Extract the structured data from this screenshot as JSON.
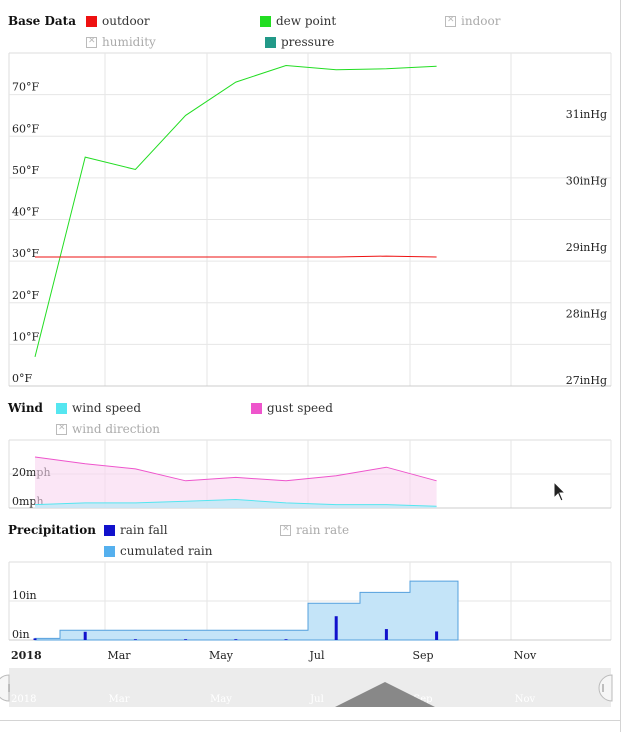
{
  "sections": {
    "base": {
      "title": "Base Data",
      "legend": [
        {
          "label": "outdoor",
          "color": "#ee1111",
          "enabled": true
        },
        {
          "label": "dew point",
          "color": "#22dd22",
          "enabled": true
        },
        {
          "label": "indoor",
          "color": "#bbbbbb",
          "enabled": false
        },
        {
          "label": "humidity",
          "color": "#bbbbbb",
          "enabled": false
        },
        {
          "label": "pressure",
          "color": "#229988",
          "enabled": true
        }
      ]
    },
    "wind": {
      "title": "Wind",
      "legend": [
        {
          "label": "wind speed",
          "color": "#55e6f0",
          "enabled": true
        },
        {
          "label": "gust speed",
          "color": "#ee55cc",
          "enabled": true
        },
        {
          "label": "wind direction",
          "color": "#bbbbbb",
          "enabled": false
        }
      ]
    },
    "precip": {
      "title": "Precipitation",
      "legend": [
        {
          "label": "rain fall",
          "color": "#1111cc",
          "enabled": true
        },
        {
          "label": "rain rate",
          "color": "#bbbbbb",
          "enabled": false
        },
        {
          "label": "cumulated rain",
          "color": "#55b0ee",
          "enabled": true
        }
      ]
    }
  },
  "chart_data": [
    {
      "type": "line",
      "x_ticks": [
        "2018",
        "Mar",
        "May",
        "Jul",
        "Sep",
        "Nov"
      ],
      "x_dates": [
        "2018-01-01",
        "2018-02-01",
        "2018-03-01",
        "2018-04-01",
        "2018-05-01",
        "2018-06-01",
        "2018-07-01",
        "2018-08-01",
        "2018-09-01"
      ],
      "y_ticks": [
        "0°F",
        "10°F",
        "20°F",
        "30°F",
        "40°F",
        "50°F",
        "60°F",
        "70°F"
      ],
      "ylim": [
        0,
        80
      ],
      "y2_ticks": [
        "27inHg",
        "28inHg",
        "29inHg",
        "30inHg",
        "31inHg"
      ],
      "y2lim": [
        27,
        32
      ],
      "series": [
        {
          "name": "dew point",
          "color": "#22dd22",
          "values": [
            7,
            55,
            52,
            65,
            73,
            77,
            76,
            76.2,
            76.8
          ]
        },
        {
          "name": "outdoor",
          "color": "#ee1111",
          "values": [
            31,
            31,
            31,
            31,
            31,
            31,
            31,
            31.2,
            31
          ]
        }
      ]
    },
    {
      "type": "area",
      "x_ticks": [
        "2018",
        "Mar",
        "May",
        "Jul",
        "Sep",
        "Nov"
      ],
      "y_ticks": [
        "0mph",
        "20mph"
      ],
      "ylim": [
        0,
        40
      ],
      "series": [
        {
          "name": "gust speed",
          "color": "#ee55cc",
          "values": [
            30,
            26,
            23,
            16,
            18,
            16,
            19,
            24,
            16
          ]
        },
        {
          "name": "wind speed",
          "color": "#55e6f0",
          "values": [
            2,
            3,
            3,
            4,
            5,
            3,
            2,
            2,
            1
          ]
        }
      ]
    },
    {
      "type": "bar",
      "x_ticks": [
        "2018",
        "Mar",
        "May",
        "Jul",
        "Sep",
        "Nov"
      ],
      "y_ticks": [
        "0in",
        "10in"
      ],
      "ylim": [
        0,
        20
      ],
      "series": [
        {
          "name": "rain fall",
          "color": "#1111cc",
          "values": [
            0.4,
            2.1,
            0.2,
            0.2,
            0.2,
            0.2,
            6.1,
            2.8,
            2.2
          ]
        },
        {
          "name": "cumulated rain",
          "color": "#55b0ee",
          "values": [
            0.4,
            2.5,
            2.5,
            2.5,
            2.5,
            2.5,
            9.4,
            12.2,
            15.1
          ]
        }
      ]
    }
  ],
  "navigator": {
    "labels": [
      "2018",
      "Mar",
      "May",
      "Jul",
      "Sep",
      "Nov"
    ]
  }
}
